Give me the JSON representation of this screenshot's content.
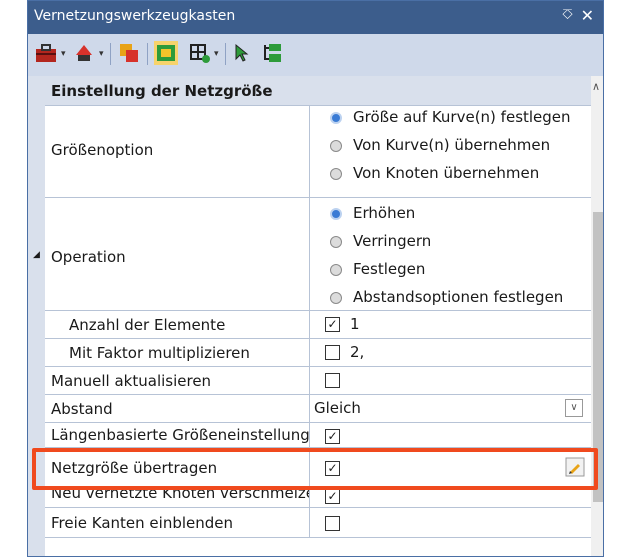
{
  "window": {
    "title": "Vernetzungswerkzeugkasten",
    "pin_icon": "pin-icon",
    "close_icon": "close-icon"
  },
  "toolbar": {
    "icons": [
      "toolbox-icon",
      "mesh-tool-icon",
      "display-icon",
      "mesh-size-icon",
      "mesh-graph-icon",
      "select-arrow-icon",
      "tree-icon"
    ]
  },
  "category": {
    "label": "Einstellung der Netzgröße"
  },
  "rows": {
    "groesse": {
      "name": "Größenoption",
      "options": [
        "Größe auf Kurve(n) festlegen",
        "Von Kurve(n) übernehmen",
        "Von Knoten übernehmen"
      ],
      "selected": 0
    },
    "operation": {
      "name": "Operation",
      "options": [
        "Erhöhen",
        "Verringern",
        "Festlegen",
        "Abstandsoptionen festlegen"
      ],
      "selected": 0
    },
    "anzahl": {
      "name": "Anzahl der Elemente",
      "checked": true,
      "value": "1"
    },
    "faktor": {
      "name": "Mit Faktor multiplizieren",
      "checked": false,
      "value": "2,"
    },
    "manuell": {
      "name": "Manuell aktualisieren",
      "checked": false
    },
    "abstand": {
      "name": "Abstand",
      "value": "Gleich"
    },
    "laengen": {
      "name": "Längenbasierte Größeneinstellung",
      "checked": true
    },
    "netz": {
      "name": "Netzgröße übertragen",
      "checked": true
    },
    "neu": {
      "name": "Neu vernetzte Knoten verschmelzen",
      "checked": true
    },
    "freie": {
      "name": "Freie Kanten einblenden",
      "checked": false
    }
  },
  "colors": {
    "title_bar": "#3c5d8c",
    "toolbar": "#cfd9ea",
    "highlight": "#f04a1e",
    "radio_on": "#3a7bd5"
  }
}
